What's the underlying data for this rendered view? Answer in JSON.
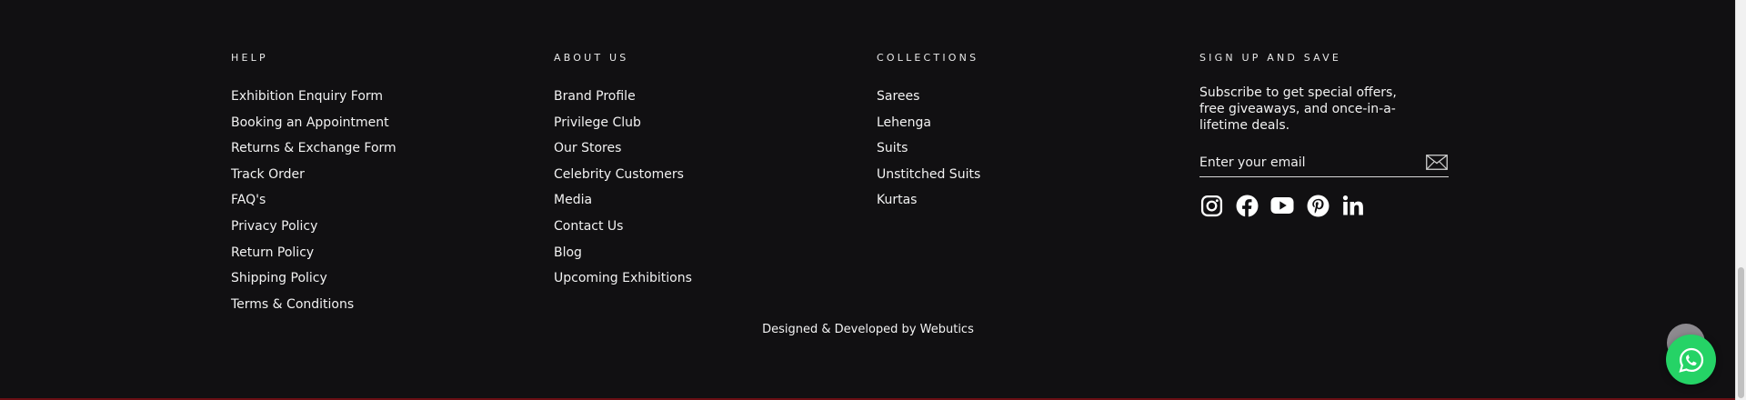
{
  "help": {
    "title": "HELP",
    "links": [
      "Exhibition Enquiry Form",
      "Booking an Appointment",
      "Returns & Exchange Form",
      "Track Order",
      "FAQ's",
      "Privacy Policy",
      "Return Policy",
      "Shipping Policy",
      "Terms & Conditions"
    ]
  },
  "about": {
    "title": "ABOUT US",
    "links": [
      "Brand Profile",
      "Privilege Club",
      "Our Stores",
      "Celebrity Customers",
      "Media",
      "Contact Us",
      "Blog",
      "Upcoming Exhibitions"
    ]
  },
  "collections": {
    "title": "COLLECTIONS",
    "links": [
      "Sarees",
      "Lehenga",
      "Suits",
      "Unstitched Suits",
      "Kurtas"
    ]
  },
  "signup": {
    "title": "SIGN UP AND SAVE",
    "text": "Subscribe to get special offers, free giveaways, and once-in-a-lifetime deals.",
    "email_placeholder": "Enter your email",
    "social": [
      "instagram-icon",
      "facebook-icon",
      "youtube-icon",
      "pinterest-icon",
      "linkedin-icon"
    ]
  },
  "credit": "Designed & Developed by Webutics",
  "colors": {
    "background": "#111012",
    "text": "#ffffff",
    "whatsapp": "#25d366",
    "bottom_border": "#6b0f14"
  }
}
